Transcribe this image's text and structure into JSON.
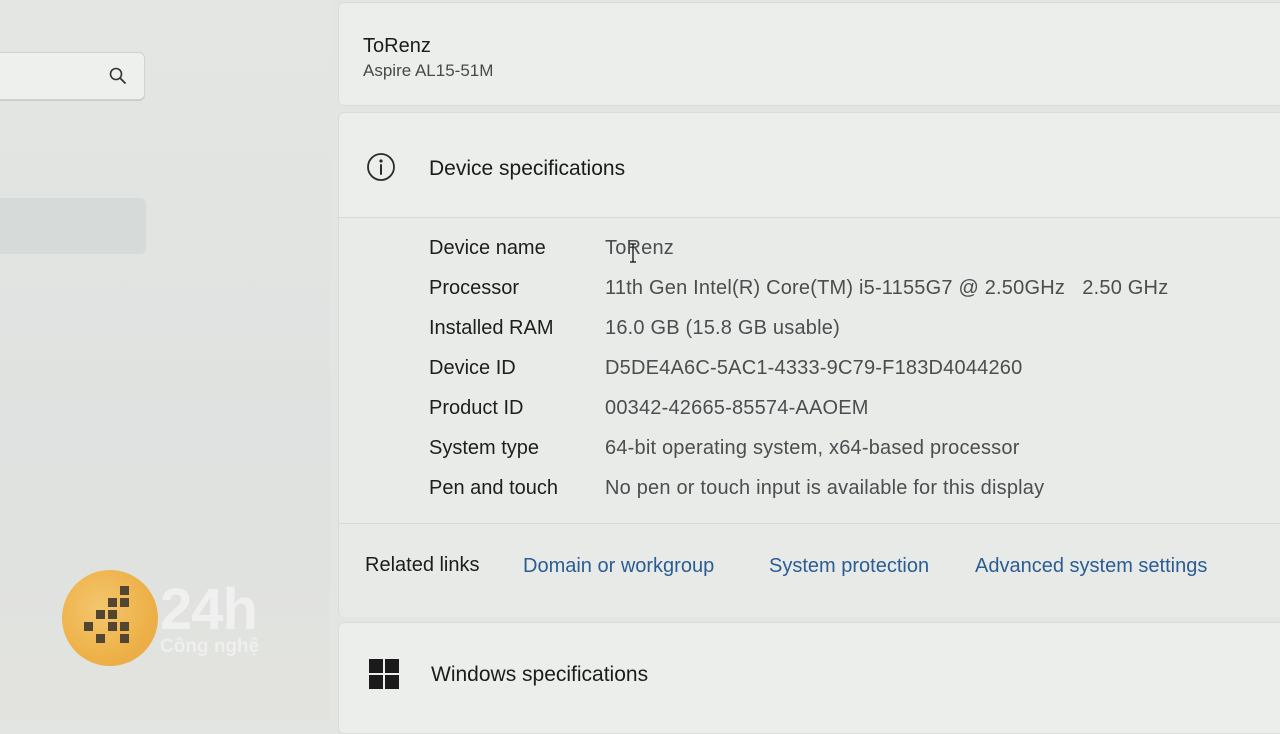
{
  "device": {
    "name": "ToRenz",
    "model": "Aspire AL15-51M"
  },
  "specs": {
    "title": "Device specifications",
    "rows": [
      {
        "label": "Device name",
        "value": "ToRenz"
      },
      {
        "label": "Processor",
        "value": "11th Gen Intel(R) Core(TM) i5-1155G7 @ 2.50GHz   2.50 GHz"
      },
      {
        "label": "Installed RAM",
        "value": "16.0 GB (15.8 GB usable)"
      },
      {
        "label": "Device ID",
        "value": "D5DE4A6C-5AC1-4333-9C79-F183D4044260"
      },
      {
        "label": "Product ID",
        "value": "00342-42665-85574-AAOEM"
      },
      {
        "label": "System type",
        "value": "64-bit operating system, x64-based processor"
      },
      {
        "label": "Pen and touch",
        "value": "No pen or touch input is available for this display"
      }
    ]
  },
  "related_links": {
    "title": "Related links",
    "links": [
      "Domain or workgroup",
      "System protection",
      "Advanced system settings"
    ]
  },
  "windows_specs": {
    "title": "Windows specifications"
  },
  "watermark": {
    "brand": "24h",
    "sub": "Công nghệ"
  },
  "colors": {
    "link": "#2a5d93",
    "accent_watermark": "#f1a92f"
  },
  "icons": [
    "search-icon",
    "info-icon",
    "windows-logo-icon",
    "text-cursor-icon"
  ]
}
